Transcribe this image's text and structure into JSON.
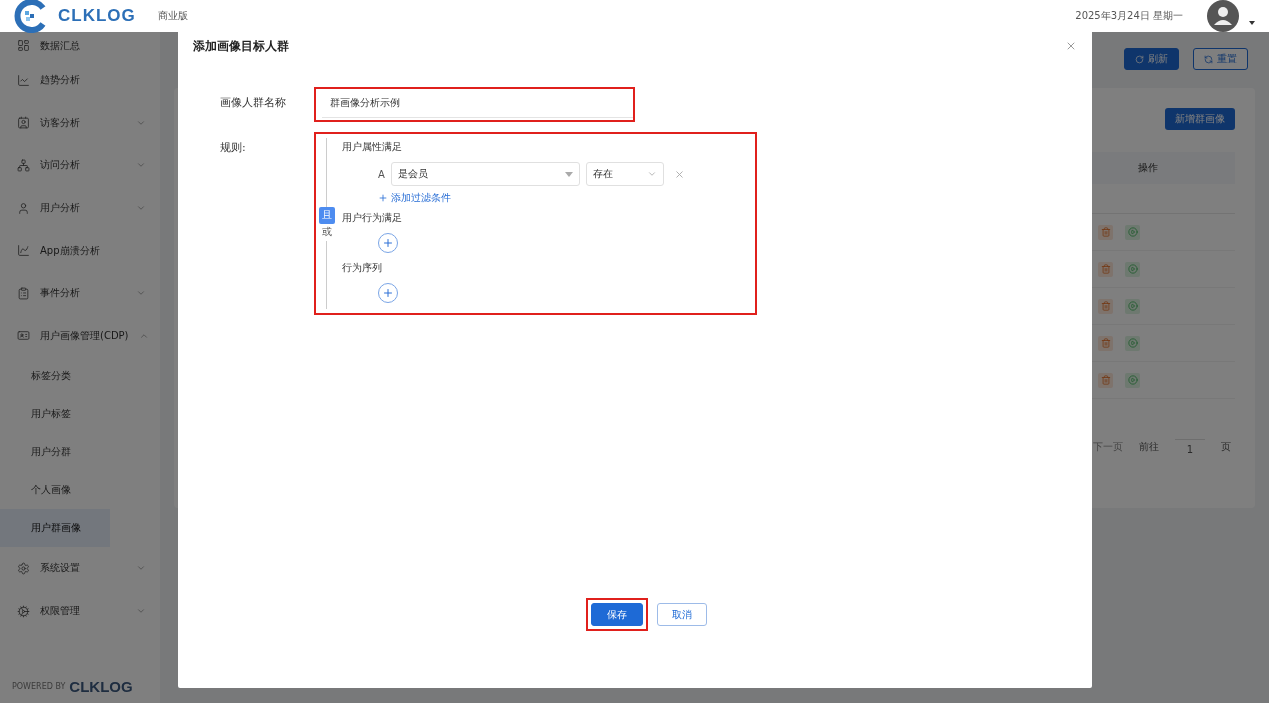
{
  "header": {
    "logo": "CLKLOG",
    "edition": "商业版",
    "date": "2025年3月24日 星期一"
  },
  "sidebar": {
    "items": [
      {
        "label": "数据汇总",
        "expandable": false
      },
      {
        "label": "趋势分析",
        "expandable": false
      },
      {
        "label": "访客分析",
        "expandable": true,
        "expanded": false
      },
      {
        "label": "访问分析",
        "expandable": true,
        "expanded": false
      },
      {
        "label": "用户分析",
        "expandable": true,
        "expanded": false
      },
      {
        "label": "App崩溃分析",
        "expandable": false
      },
      {
        "label": "事件分析",
        "expandable": true,
        "expanded": false
      },
      {
        "label": "用户画像管理(CDP)",
        "expandable": true,
        "expanded": true,
        "children": [
          {
            "label": "标签分类",
            "selected": false
          },
          {
            "label": "用户标签",
            "selected": false
          },
          {
            "label": "用户分群",
            "selected": false
          },
          {
            "label": "个人画像",
            "selected": false
          },
          {
            "label": "用户群画像",
            "selected": true
          }
        ]
      },
      {
        "label": "系统设置",
        "expandable": true,
        "expanded": false
      },
      {
        "label": "权限管理",
        "expandable": true,
        "expanded": false
      }
    ],
    "footer": {
      "powered_by": "POWERED BY",
      "brand": "CLKLOG"
    }
  },
  "toolbar": {
    "buttons": [
      {
        "label": "刷新",
        "kind": "primary"
      },
      {
        "label": "重置",
        "kind": "outline"
      }
    ]
  },
  "card": {
    "add_button": "新增群画像",
    "table": {
      "columns": [
        "操作"
      ],
      "rows": [
        {
          "kind": "actions"
        },
        {
          "kind": "actions"
        },
        {
          "kind": "actions"
        },
        {
          "kind": "actions"
        },
        {
          "kind": "actions"
        }
      ]
    },
    "pagination": {
      "next": "下一页",
      "goto": "前往",
      "page": "1",
      "suffix": "页"
    }
  },
  "dialog": {
    "title": "添加画像目标人群",
    "name_field": {
      "label": "画像人群名称",
      "value": "群画像分析示例",
      "highlighted": true
    },
    "rules": {
      "label": "规则:",
      "highlighted": true,
      "logic": [
        {
          "label": "且",
          "selected": true
        },
        {
          "label": "或",
          "selected": false
        }
      ],
      "groups": [
        {
          "title": "用户属性满足",
          "kind": "conditions",
          "conditions": [
            {
              "letter": "A",
              "property": "是会员",
              "operator": "存在"
            }
          ],
          "add_link": "添加过滤条件"
        },
        {
          "title": "用户行为满足",
          "kind": "add"
        },
        {
          "title": "行为序列",
          "kind": "add"
        }
      ]
    },
    "buttons": [
      {
        "label": "保存",
        "kind": "primary",
        "highlighted": true
      },
      {
        "label": "取消",
        "kind": "default",
        "highlighted": false
      }
    ]
  }
}
